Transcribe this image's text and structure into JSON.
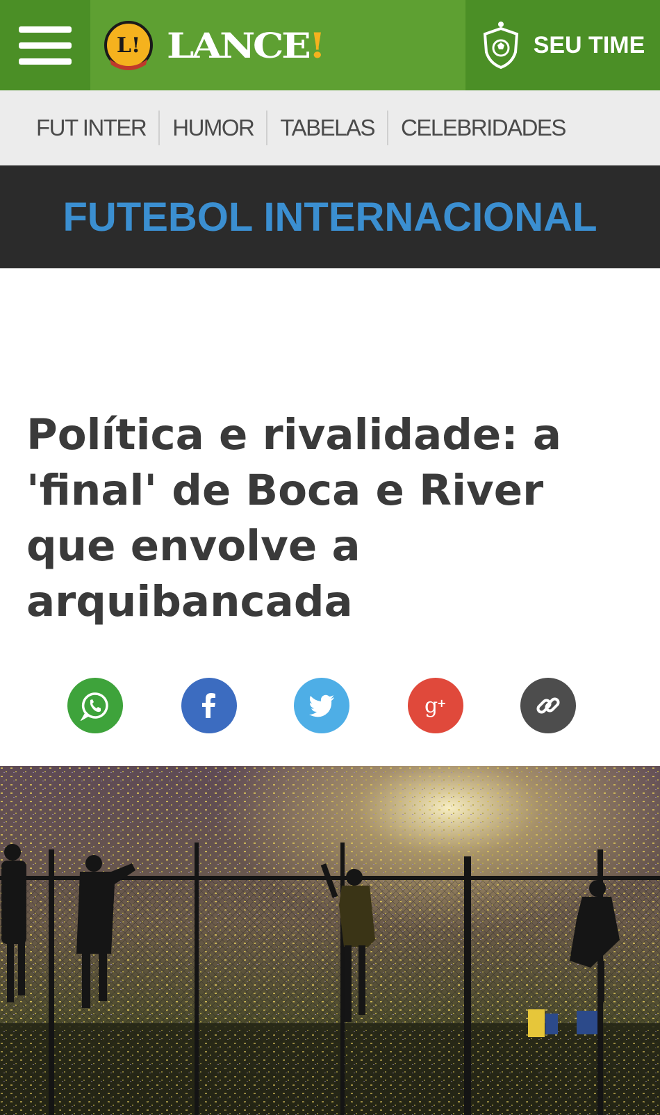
{
  "header": {
    "logo_text": "LANCE",
    "logo_excl": "!",
    "badge_letter": "L!",
    "seu_time_label": "SEU TIME"
  },
  "subnav": {
    "items": [
      "FUT INTER",
      "HUMOR",
      "TABELAS",
      "CELEBRIDADES"
    ]
  },
  "section": {
    "title": "FUTEBOL INTERNACIONAL"
  },
  "article": {
    "headline": "Política e rivalidade: a 'final' de Boca e River que envolve a arquibancada"
  },
  "share": {
    "buttons": [
      {
        "name": "whatsapp",
        "color": "#3ea33b",
        "icon": "whatsapp-icon"
      },
      {
        "name": "facebook",
        "color": "#3c6cc0",
        "icon": "facebook-icon"
      },
      {
        "name": "twitter",
        "color": "#4eaee6",
        "icon": "twitter-icon"
      },
      {
        "name": "google-plus",
        "color": "#e0493b",
        "icon": "google-plus-icon"
      },
      {
        "name": "copy-link",
        "color": "#4d4d4d",
        "icon": "link-icon"
      }
    ]
  },
  "colors": {
    "brand_green": "#5ea032",
    "brand_green_dark": "#4b8f26",
    "accent_yellow": "#f5b21e",
    "section_blue": "#3b8fd1"
  }
}
